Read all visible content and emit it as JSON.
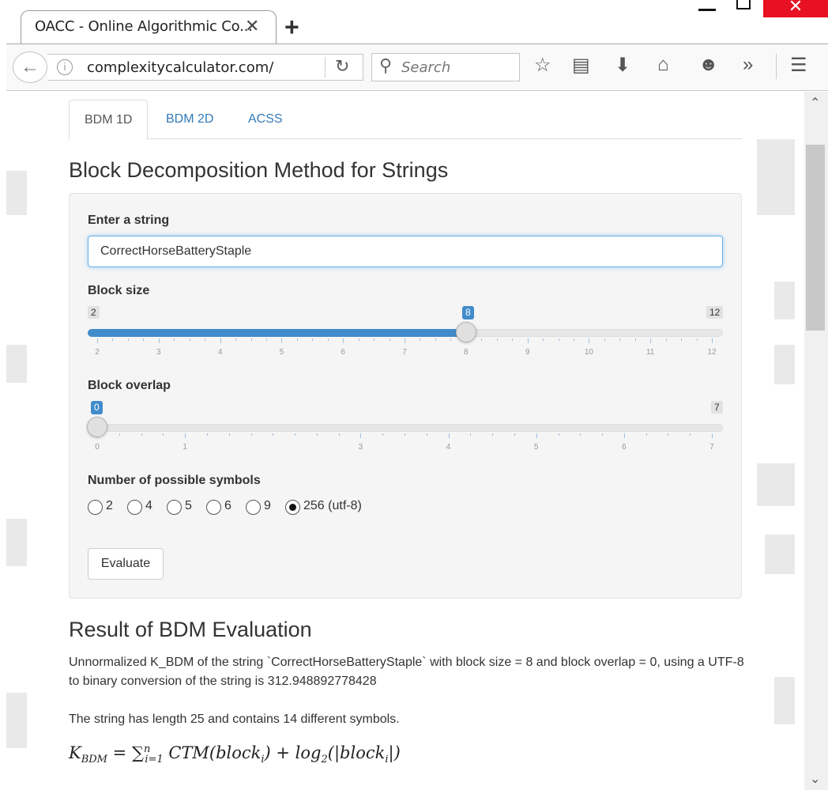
{
  "browser": {
    "tab_title": "OACC - Online Algorithmic Co...",
    "url": "complexitycalculator.com/",
    "search_placeholder": "Search"
  },
  "tabs": [
    {
      "label": "BDM 1D",
      "active": true
    },
    {
      "label": "BDM 2D",
      "active": false
    },
    {
      "label": "ACSS",
      "active": false
    }
  ],
  "form": {
    "title": "Block Decomposition Method for Strings",
    "string_label": "Enter a string",
    "string_value": "CorrectHorseBatteryStaple",
    "block_size": {
      "label": "Block size",
      "min": 2,
      "max": 12,
      "value": 8,
      "min_text": "2",
      "max_text": "12",
      "value_text": "8",
      "ticks": [
        "2",
        "3",
        "4",
        "5",
        "6",
        "7",
        "8",
        "9",
        "10",
        "11",
        "12"
      ]
    },
    "block_overlap": {
      "label": "Block overlap",
      "min": 0,
      "max": 7,
      "value": 0,
      "min_text": "0",
      "max_text": "7",
      "value_text": "0",
      "ticks": [
        "0",
        "1",
        "3",
        "4",
        "5",
        "6",
        "7"
      ]
    },
    "symbols_label": "Number of possible symbols",
    "symbols": [
      {
        "label": "2",
        "checked": false
      },
      {
        "label": "4",
        "checked": false
      },
      {
        "label": "5",
        "checked": false
      },
      {
        "label": "6",
        "checked": false
      },
      {
        "label": "9",
        "checked": false
      },
      {
        "label": "256 (utf-8)",
        "checked": true
      }
    ],
    "evaluate_label": "Evaluate"
  },
  "result": {
    "title": "Result of BDM Evaluation",
    "line1": "Unnormalized K_BDM of the string `CorrectHorseBatteryStaple` with block size = 8 and block overlap = 0, using a UTF-8 to binary conversion of the string is 312.948892778428",
    "line2": "The string has length 25 and contains 14 different symbols.",
    "formula": {
      "lhs": "K",
      "lhs_sub": "BDM",
      "eq": " = ∑",
      "sum_sub": "i=1",
      "sum_sup": "n",
      "ctm": " CTM(block",
      "ctm_sub": "i",
      "mid": ") + log",
      "log_sub": "2",
      "abs": "(|block",
      "abs_sub": "i",
      "end": "|)"
    }
  }
}
